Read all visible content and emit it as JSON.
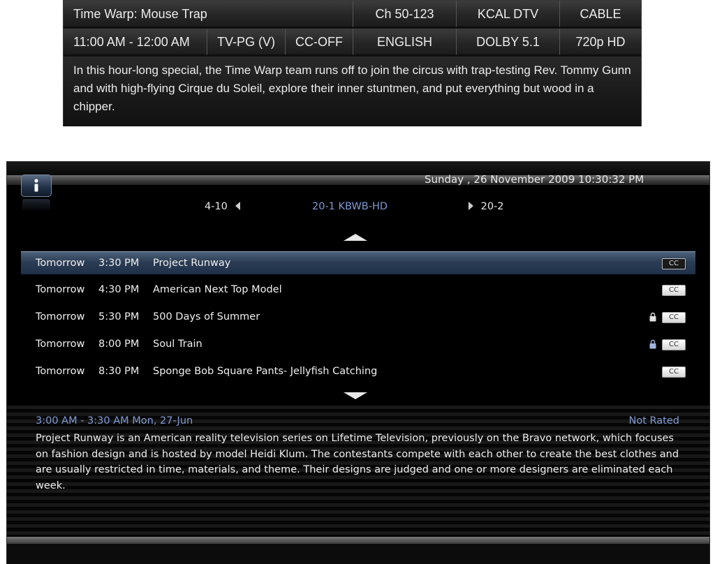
{
  "info_panel": {
    "title": "Time Warp: Mouse Trap",
    "channel": "Ch 50-123",
    "station": "KCAL DTV",
    "source": "CABLE",
    "time_range": "11:00 AM - 12:00 AM",
    "rating": "TV-PG (V)",
    "cc_status": "CC-OFF",
    "language": "ENGLISH",
    "audio": "DOLBY 5.1",
    "resolution": "720p HD",
    "description": "In this hour-long special, the Time Warp team runs off to join the circus with trap-testing Rev. Tommy Gunn and with high-flying Cirque du Soleil, explore their inner stuntmen, and put everything but wood in a chipper."
  },
  "guide": {
    "info_icon": "info-icon",
    "datetime": "Sunday , 26 November 2009 10:30:32 PM",
    "channel_prev": "4-10",
    "channel_current": "20-1 KBWB-HD",
    "channel_next": "20-2",
    "programs": [
      {
        "day": "Tomorrow",
        "time": "3:30 PM",
        "title": "Project Runway",
        "cc": "CC",
        "locked": false,
        "selected": true
      },
      {
        "day": "Tomorrow",
        "time": "4:30 PM",
        "title": "American Next Top Model",
        "cc": "CC",
        "locked": false,
        "selected": false
      },
      {
        "day": "Tomorrow",
        "time": "5:30 PM",
        "title": "500 Days of Summer",
        "cc": "CC",
        "locked": true,
        "selected": false
      },
      {
        "day": "Tomorrow",
        "time": "8:00 PM",
        "title": "Soul Train",
        "cc": "CC",
        "locked": true,
        "selected": false
      },
      {
        "day": "Tomorrow",
        "time": "8:30 PM",
        "title": "Sponge Bob Square Pants- Jellyfish Catching",
        "cc": "CC",
        "locked": false,
        "selected": false
      }
    ],
    "detail": {
      "times": "3:00 AM - 3:30 AM Mon, 27-Jun",
      "rating": "Not Rated",
      "description": "Project Runway is an American reality television series on Lifetime Television, previously on the Bravo network, which focuses on fashion design and is hosted by model Heidi Klum. The contestants compete with each other to create the best clothes and are usually restricted in time, materials, and theme. Their designs are judged and one or more designers are eliminated each week."
    },
    "colors": {
      "accent_blue": "#7f9bd6",
      "selection": "#2b3d55"
    }
  }
}
